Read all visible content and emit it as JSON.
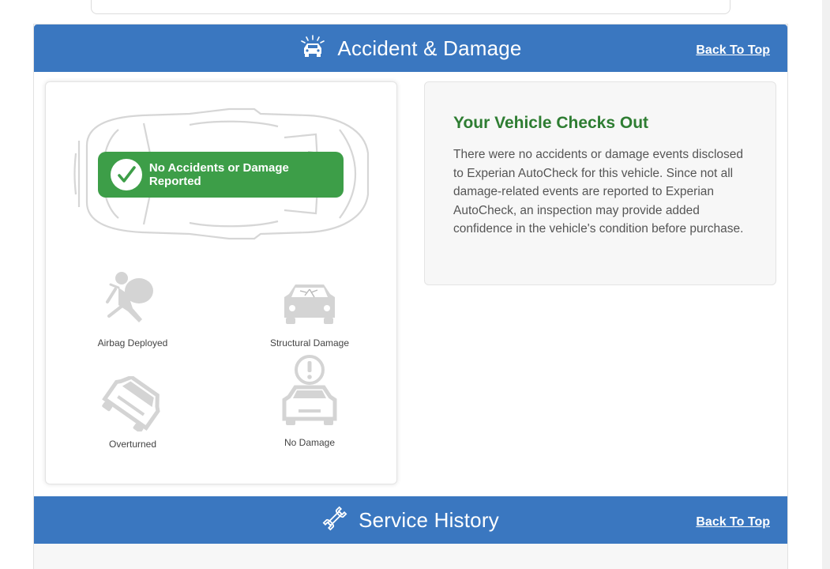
{
  "accident_section": {
    "title": "Accident & Damage",
    "back_to_top": "Back To Top",
    "badge": "No Accidents or Damage Reported",
    "icons": [
      {
        "label": "Airbag Deployed",
        "icon": "airbag-icon"
      },
      {
        "label": "Structural Damage",
        "icon": "structural-damage-icon"
      },
      {
        "label": "Overturned",
        "icon": "overturned-car-icon"
      },
      {
        "label": "No Damage",
        "icon": "no-damage-car-icon"
      }
    ],
    "result_heading": "Your Vehicle Checks Out",
    "result_text": "There were no accidents or damage events disclosed to Experian AutoCheck for this vehicle. Since not all damage-related events are reported to Experian AutoCheck, an inspection may provide added confidence in the vehicle's condition before purchase."
  },
  "service_section": {
    "title": "Service History",
    "back_to_top": "Back To Top"
  },
  "colors": {
    "header_blue": "#3a77c0",
    "badge_green": "#3d9e48",
    "heading_green": "#2e7d32"
  }
}
